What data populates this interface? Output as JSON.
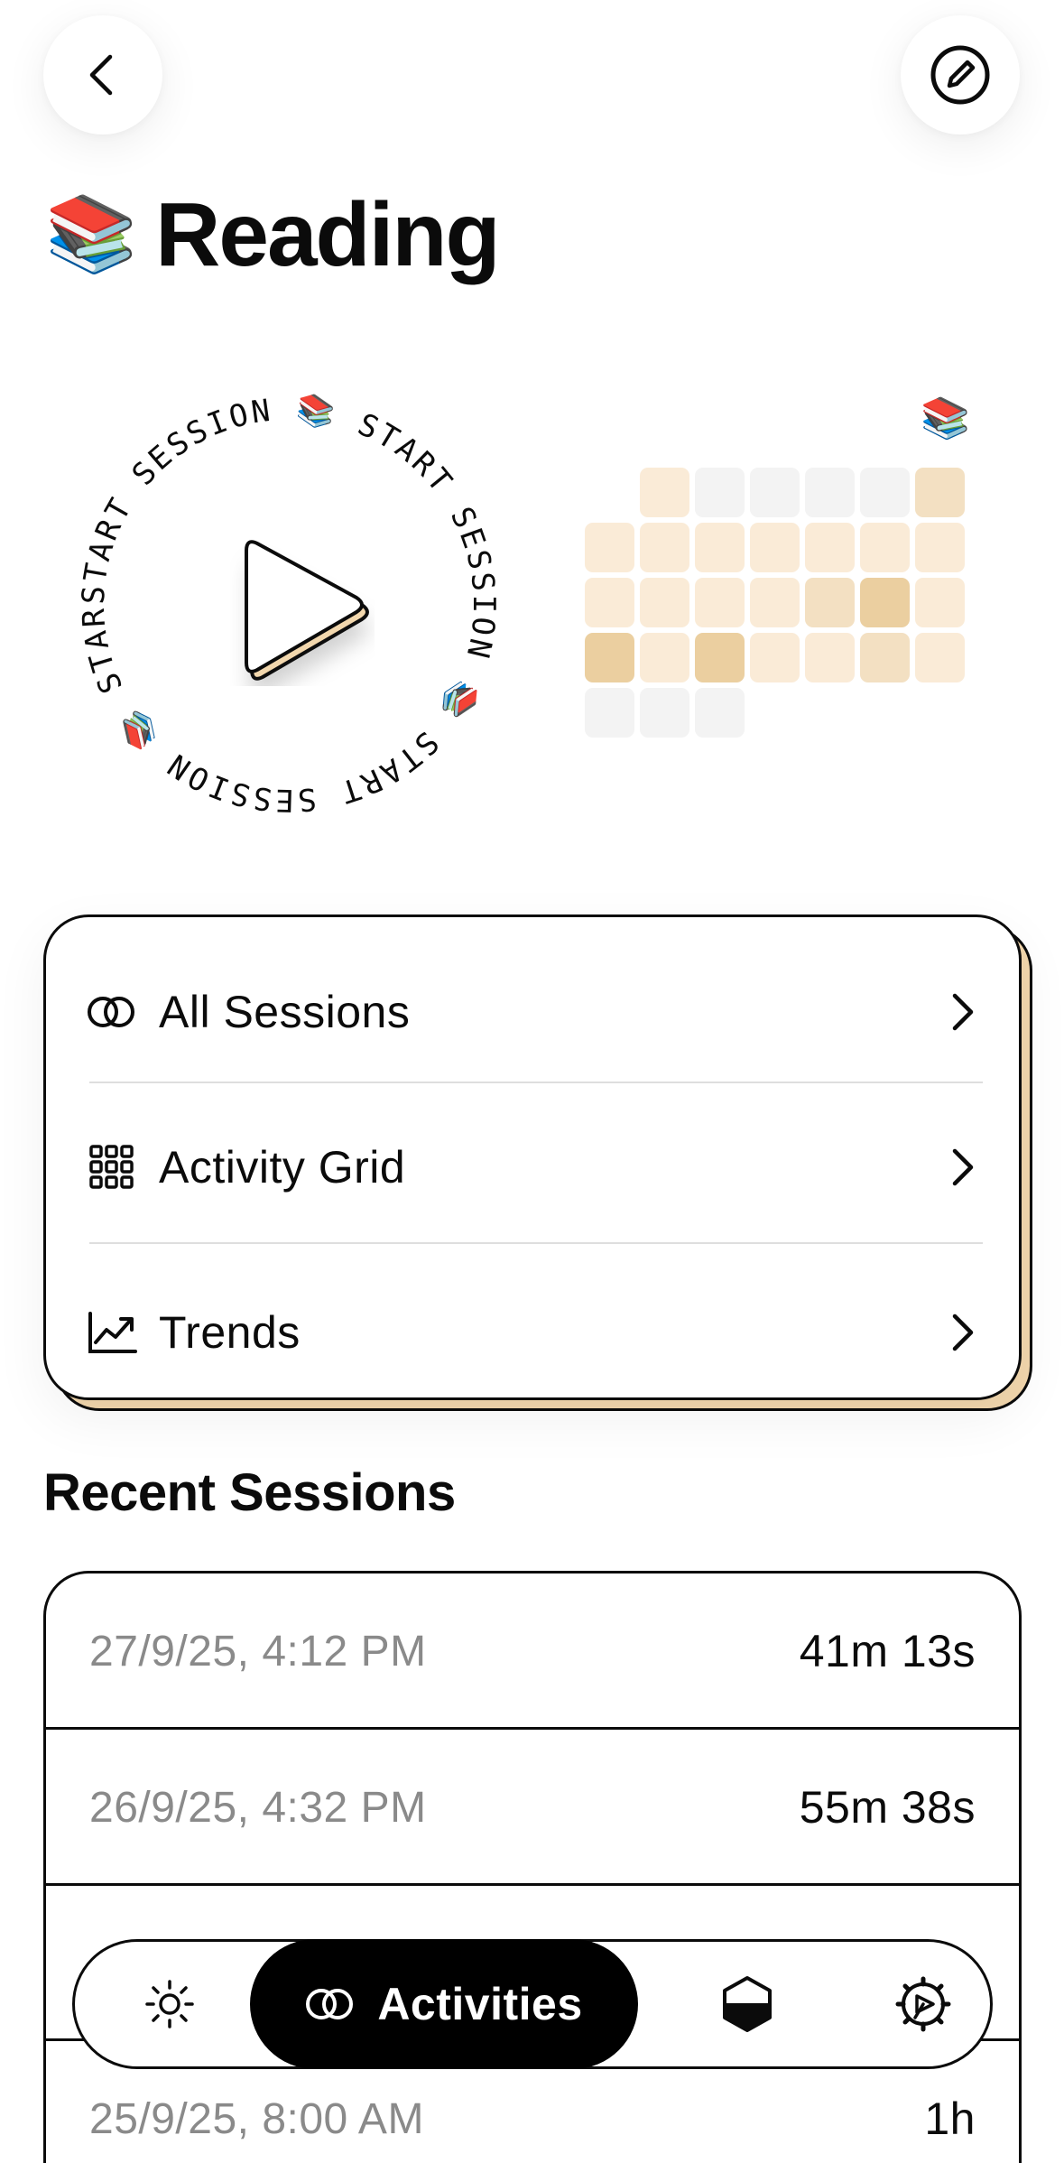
{
  "header": {
    "title": "Reading",
    "title_emoji": "📚",
    "back_icon": "chevron-left-icon",
    "edit_icon": "pencil-circle-icon"
  },
  "start_dial": {
    "ring_text": "START SESSION 📚 START SESSION 📚 START SESSION 📚 START SESSION 📚 ",
    "play_icon": "play-icon",
    "accent_color": "#f2d7ad"
  },
  "mini_grid": {
    "emoji": "📚",
    "rows": [
      [
        null,
        1,
        0,
        0,
        0,
        0,
        2
      ],
      [
        1,
        1,
        1,
        1,
        1,
        1,
        1
      ],
      [
        1,
        1,
        1,
        1,
        2,
        3,
        1
      ],
      [
        3,
        1,
        3,
        1,
        1,
        2,
        1
      ],
      [
        0,
        0,
        0,
        null,
        null,
        null,
        null
      ]
    ],
    "colors": [
      "#f3f3f3",
      "#faebd7",
      "#f3e0c2",
      "#ebcfa0"
    ]
  },
  "nav": {
    "items": [
      {
        "label": "All Sessions",
        "icon": "sessions-icon"
      },
      {
        "label": "Activity Grid",
        "icon": "grid-icon"
      },
      {
        "label": "Trends",
        "icon": "trend-chart-icon"
      }
    ]
  },
  "recent": {
    "title": "Recent Sessions",
    "sessions": [
      {
        "date": "27/9/25, 4:12 PM",
        "duration": "41m 13s"
      },
      {
        "date": "26/9/25, 4:32 PM",
        "duration": "55m 38s"
      },
      {
        "date": "",
        "duration": ""
      },
      {
        "date": "25/9/25, 8:00 AM",
        "duration": "1h"
      }
    ]
  },
  "tabbar": {
    "tabs": [
      {
        "icon": "sun-icon",
        "label": ""
      },
      {
        "icon": "sessions-icon",
        "label": "Activities",
        "active": true
      },
      {
        "icon": "hexagon-half-icon",
        "label": ""
      },
      {
        "icon": "settings-gear-icon",
        "label": ""
      }
    ]
  }
}
